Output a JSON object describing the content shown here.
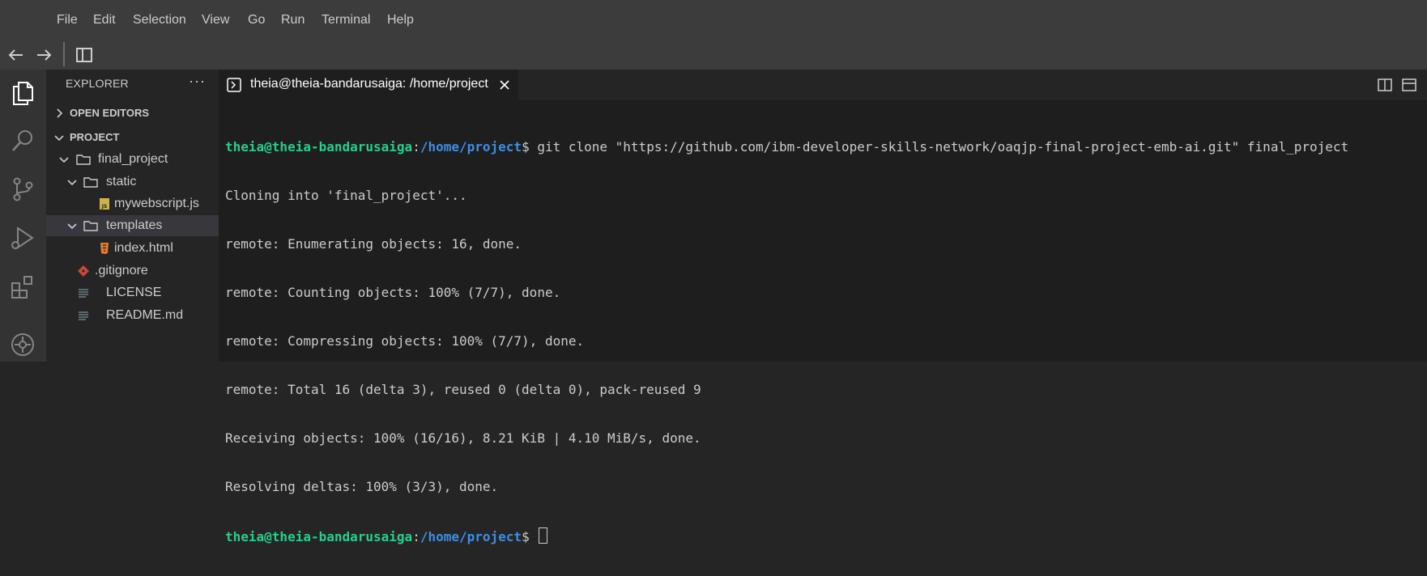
{
  "menu": [
    "File",
    "Edit",
    "Selection",
    "View",
    "Go",
    "Run",
    "Terminal",
    "Help"
  ],
  "toolbar": {
    "back_icon": "arrow-left-icon",
    "forward_icon": "arrow-right-icon",
    "panel_icon": "toggle-panel-icon"
  },
  "activity_bar": [
    "files-icon",
    "search-icon",
    "source-control-icon",
    "run-debug-icon",
    "extensions-icon",
    "cloud-icon"
  ],
  "explorer": {
    "title": "EXPLORER",
    "more": "···",
    "open_editors": "OPEN EDITORS",
    "project": "PROJECT",
    "tree": [
      {
        "name": "final_project",
        "type": "folder",
        "expanded": true
      },
      {
        "name": "static",
        "type": "folder",
        "expanded": true
      },
      {
        "name": "mywebscript.js",
        "type": "js"
      },
      {
        "name": "templates",
        "type": "folder",
        "expanded": true,
        "selected": true
      },
      {
        "name": "index.html",
        "type": "html"
      },
      {
        "name": ".gitignore",
        "type": "git"
      },
      {
        "name": "LICENSE",
        "type": "text"
      },
      {
        "name": "README.md",
        "type": "text"
      }
    ]
  },
  "tab": {
    "label": "theia@theia-bandarusaiga: /home/project",
    "icon": "terminal-icon",
    "close_icon": "close-icon"
  },
  "terminal": {
    "prompt_user": "theia@theia-bandarusaiga",
    "prompt_sep": ":",
    "prompt_path": "/home/project",
    "prompt_end": "$ ",
    "command": "git clone \"https://github.com/ibm-developer-skills-network/oaqjp-final-project-emb-ai.git\" final_project",
    "output": [
      "Cloning into 'final_project'...",
      "remote: Enumerating objects: 16, done.",
      "remote: Counting objects: 100% (7/7), done.",
      "remote: Compressing objects: 100% (7/7), done.",
      "remote: Total 16 (delta 3), reused 0 (delta 0), pack-reused 9",
      "Receiving objects: 100% (16/16), 8.21 KiB | 4.10 MiB/s, done.",
      "Resolving deltas: 100% (3/3), done."
    ]
  },
  "colors": {
    "prompt_user": "#23d18b",
    "prompt_path": "#3b8eea",
    "terminal_bg": "#1e1e1e",
    "sidebar_bg": "#252526",
    "activity_bg": "#333333",
    "menubar_bg": "#3c3c3c"
  }
}
